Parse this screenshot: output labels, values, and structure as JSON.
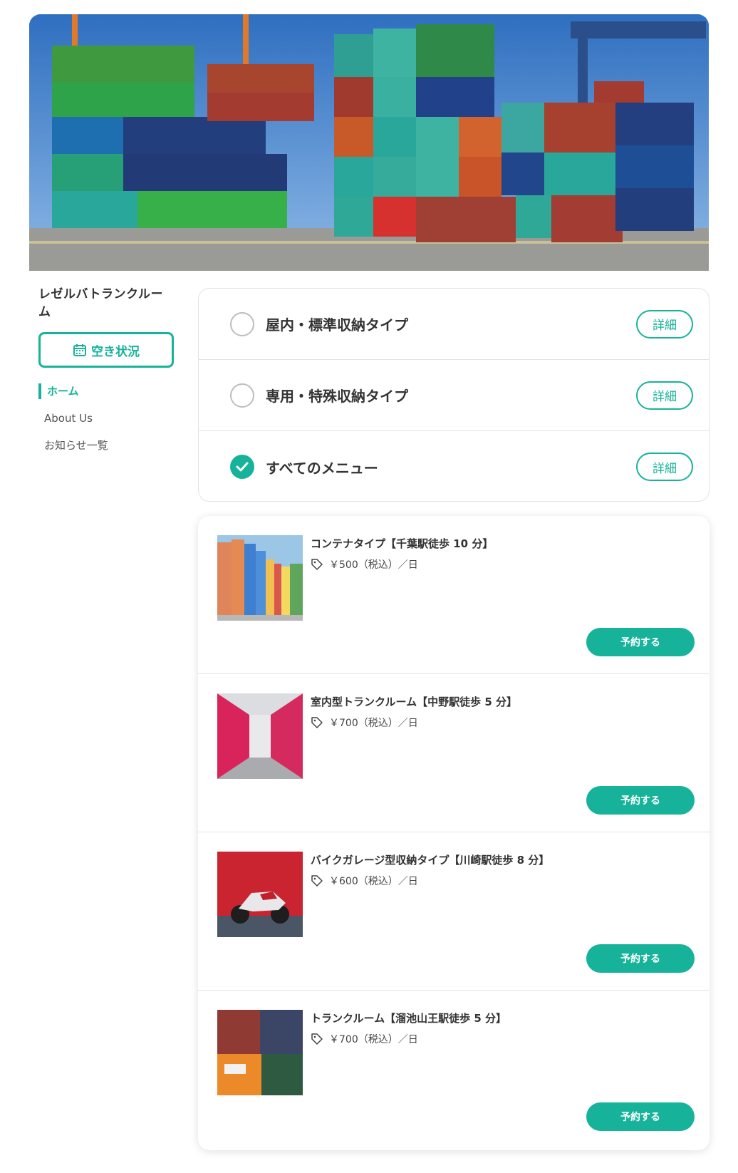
{
  "site": {
    "title": "レゼルバトランクルーム"
  },
  "sidebar": {
    "availability_button": "空き状況",
    "nav": [
      {
        "label": "ホーム",
        "active": true
      },
      {
        "label": "About Us",
        "active": false
      },
      {
        "label": "お知らせ一覧",
        "active": false
      }
    ]
  },
  "filters": {
    "detail_label": "詳細",
    "items": [
      {
        "label": "屋内・標準収納タイプ",
        "checked": false
      },
      {
        "label": "専用・特殊収納タイプ",
        "checked": false
      },
      {
        "label": "すべてのメニュー",
        "checked": true
      }
    ]
  },
  "listings": {
    "reserve_label": "予約する",
    "items": [
      {
        "title": "コンテナタイプ【千葉駅徒歩 10 分】",
        "price": "￥500（税込）／日",
        "image_icon": "colorful-containers"
      },
      {
        "title": "室内型トランクルーム【中野駅徒歩 5 分】",
        "price": "￥700（税込）／日",
        "image_icon": "indoor-storage-corridor"
      },
      {
        "title": "バイクガレージ型収納タイプ【川崎駅徒歩 8 分】",
        "price": "￥600（税込）／日",
        "image_icon": "motorcycle-red-wall"
      },
      {
        "title": "トランクルーム【溜池山王駅徒歩 5 分】",
        "price": "￥700（税込）／日",
        "image_icon": "stacked-containers"
      }
    ]
  },
  "colors": {
    "accent": "#16b39a",
    "text": "#333333",
    "border": "#e3e3e3"
  }
}
